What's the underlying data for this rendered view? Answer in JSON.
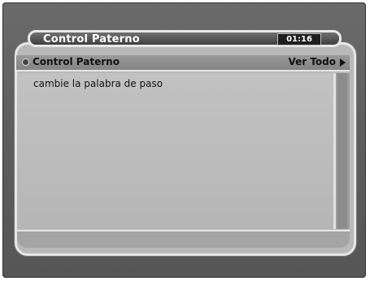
{
  "header": {
    "title": "Control Paterno",
    "clock": "01:16"
  },
  "menu": {
    "item_label": "Control Paterno",
    "item_value": "Ver Todo"
  },
  "content": {
    "message": "cambie la palabra de paso"
  }
}
